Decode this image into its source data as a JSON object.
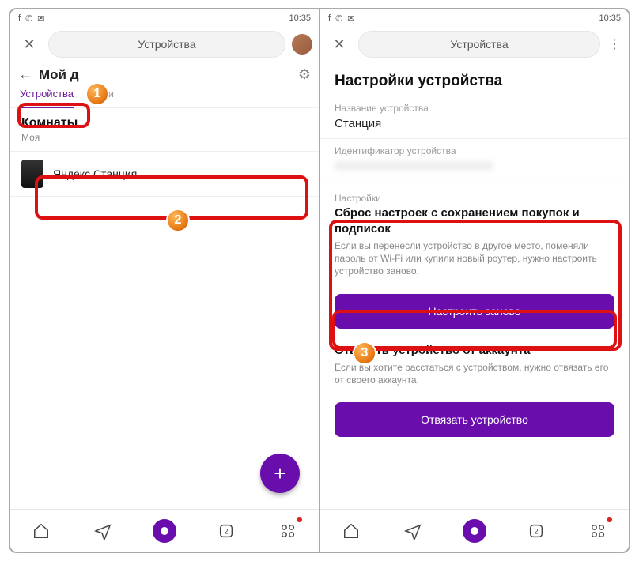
{
  "status": {
    "time": "10:35"
  },
  "left": {
    "search_title": "Устройства",
    "header_title": "Мой д",
    "tabs": {
      "devices": "Устройства",
      "scenarios": "арии"
    },
    "rooms_title": "Комнаты",
    "rooms_sub": "Моя",
    "device_name": "Яндекс Станция",
    "nav_badge": "2"
  },
  "right": {
    "search_title": "Устройства",
    "page_title": "Настройки устройства",
    "name_label": "Название устройства",
    "name_value": "Станция",
    "id_label": "Идентификатор устройства",
    "id_value": "XXXXXXXXXXXXXXXXXXXX",
    "settings_head": "Настройки",
    "reset_title": "Сброс настроек с сохранением покупок и подписок",
    "reset_desc": "Если вы перенесли устройство в другое место, поменяли пароль от Wi-Fi или купили новый роутер, нужно настроить устройство заново.",
    "reset_btn": "Настроить заново",
    "unlink_title": "Отвязать устройство от аккаунта",
    "unlink_desc": "Если вы хотите расстаться с устройством, нужно отвязать его от своего аккаунта.",
    "unlink_btn": "Отвязать устройство",
    "nav_badge": "2"
  },
  "annotations": {
    "n1": "1",
    "n2": "2",
    "n3": "3"
  }
}
